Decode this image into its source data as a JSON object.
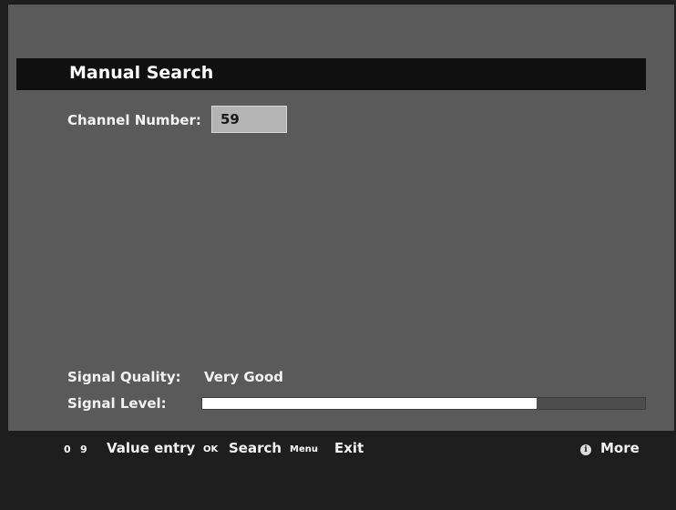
{
  "header": {
    "title": "Manual Search"
  },
  "channel": {
    "label": "Channel Number:",
    "value": "59"
  },
  "signal": {
    "quality_label": "Signal Quality:",
    "quality_value": "Very Good",
    "level_label": "Signal Level:",
    "level_fraction": 0.755
  },
  "footer": {
    "key_zero": "0",
    "key_nine": "9",
    "value_entry_label": "Value entry",
    "key_ok": "OK",
    "search_label": "Search",
    "key_menu": "Menu",
    "exit_label": "Exit",
    "info_icon": "info-icon",
    "more_label": "More"
  },
  "colors": {
    "panel": "#5a5a5a",
    "title_bar": "#101010",
    "field_bg": "#b4b4b4",
    "level_fill": "#ffffff"
  }
}
